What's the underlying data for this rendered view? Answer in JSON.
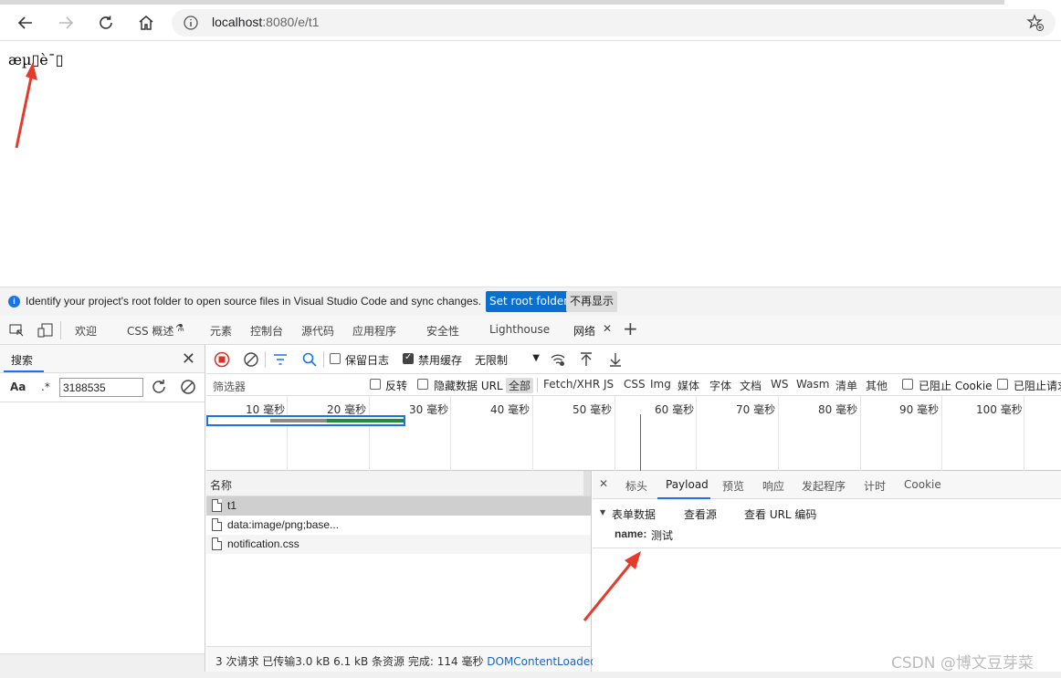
{
  "browser": {
    "url_host": "localhost",
    "url_rest": ":8080/e/t1"
  },
  "page": {
    "body_text": "æµ▯è¯▯"
  },
  "infobar": {
    "message": "Identify your project's root folder to open source files in Visual Studio Code and sync changes.",
    "primary_button": "Set root folder",
    "secondary_button": "不再显示"
  },
  "devtools_tabs": [
    "欢迎",
    "CSS 概述",
    "元素",
    "控制台",
    "源代码",
    "应用程序",
    "安全性",
    "Lighthouse",
    "网络"
  ],
  "search_panel": {
    "title": "搜索",
    "aa": "Aa",
    "regex": ".*",
    "query": "3188535"
  },
  "toolbar": {
    "preserve_log": "保留日志",
    "disable_cache": "禁用缓存",
    "throttle": "无限制"
  },
  "filter": {
    "placeholder": "筛选器",
    "invert": "反转",
    "hide_data_urls": "隐藏数据 URL",
    "types": [
      "全部",
      "Fetch/XHR",
      "JS",
      "CSS",
      "Img",
      "媒体",
      "字体",
      "文档",
      "WS",
      "Wasm",
      "清单",
      "其他"
    ],
    "blocked_cookies": "已阻止 Cookie",
    "blocked_requests": "已阻止请求"
  },
  "overview": {
    "ticks": [
      "10 毫秒",
      "20 毫秒",
      "30 毫秒",
      "40 毫秒",
      "50 毫秒",
      "60 毫秒",
      "70 毫秒",
      "80 毫秒",
      "90 毫秒",
      "100 毫秒"
    ]
  },
  "requests": {
    "column_name": "名称",
    "rows": [
      "t1",
      "data:image/png;base...",
      "notification.css"
    ],
    "status_text": "3 次请求  已传输3.0 kB  6.1 kB 条资源  完成: 114 毫秒  ",
    "status_link": "DOMContentLoaded"
  },
  "detail": {
    "tabs": [
      "标头",
      "Payload",
      "预览",
      "响应",
      "发起程序",
      "计时",
      "Cookie"
    ],
    "section_title": "表单数据",
    "view_source": "查看源",
    "view_url_encoded": "查看 URL 编码",
    "param_key": "name:",
    "param_value": "测试"
  },
  "watermark": "CSDN @博文豆芽菜"
}
